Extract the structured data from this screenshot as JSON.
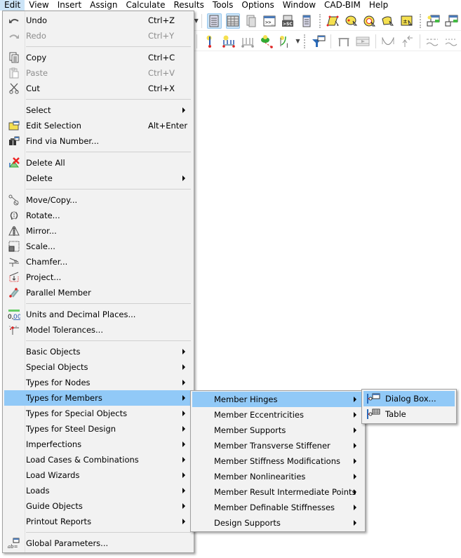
{
  "menubar": {
    "items": [
      "Edit",
      "View",
      "Insert",
      "Assign",
      "Calculate",
      "Results",
      "Tools",
      "Options",
      "Window",
      "CAD-BIM",
      "Help"
    ],
    "active": "Edit"
  },
  "toolbar1": {
    "icons": [
      "dropdown-arrow-icon",
      "table-list-icon",
      "table-grid-icon",
      "report-icon",
      "console-icon",
      "script-icon",
      "list-icon",
      "surface-select-icon",
      "solid-select-icon",
      "opening-select-icon",
      "area-select-icon",
      "value-select-icon",
      "copy-model-icon",
      "export-model-icon"
    ]
  },
  "toolbar2": {
    "icons": [
      "node-load-icon",
      "member-load-icon",
      "member-load-disabled-icon",
      "surface-load-icon",
      "free-load-icon",
      "filter-icon",
      "frame-icon",
      "film-icon",
      "deformation-icon",
      "arrows-icon",
      "line-wave-icon",
      "line-wave2-icon"
    ]
  },
  "edit_menu": {
    "items": [
      {
        "type": "item",
        "label": "Undo",
        "shortcut": "Ctrl+Z",
        "icon": "undo-icon",
        "disabled": false
      },
      {
        "type": "item",
        "label": "Redo",
        "shortcut": "Ctrl+Y",
        "icon": "redo-icon",
        "disabled": true
      },
      {
        "type": "separator"
      },
      {
        "type": "item",
        "label": "Copy",
        "shortcut": "Ctrl+C",
        "icon": "copy-icon",
        "disabled": false
      },
      {
        "type": "item",
        "label": "Paste",
        "shortcut": "Ctrl+V",
        "icon": "paste-icon",
        "disabled": true
      },
      {
        "type": "item",
        "label": "Cut",
        "shortcut": "Ctrl+X",
        "icon": "cut-icon",
        "disabled": false
      },
      {
        "type": "separator"
      },
      {
        "type": "item",
        "label": "Select",
        "submenu": true
      },
      {
        "type": "item",
        "label": "Edit Selection",
        "shortcut": "Alt+Enter",
        "icon": "edit-selection-icon"
      },
      {
        "type": "item",
        "label": "Find via Number...",
        "icon": "binoculars-icon"
      },
      {
        "type": "separator"
      },
      {
        "type": "item",
        "label": "Delete All",
        "icon": "delete-all-icon"
      },
      {
        "type": "item",
        "label": "Delete",
        "submenu": true
      },
      {
        "type": "separator"
      },
      {
        "type": "item",
        "label": "Move/Copy...",
        "icon": "move-copy-icon"
      },
      {
        "type": "item",
        "label": "Rotate...",
        "icon": "rotate-icon"
      },
      {
        "type": "item",
        "label": "Mirror...",
        "icon": "mirror-icon"
      },
      {
        "type": "item",
        "label": "Scale...",
        "icon": "scale-icon"
      },
      {
        "type": "item",
        "label": "Chamfer...",
        "icon": "chamfer-icon"
      },
      {
        "type": "item",
        "label": "Project...",
        "icon": "project-icon"
      },
      {
        "type": "item",
        "label": "Parallel Member",
        "icon": "parallel-member-icon"
      },
      {
        "type": "separator"
      },
      {
        "type": "item",
        "label": "Units and Decimal Places...",
        "icon": "units-icon"
      },
      {
        "type": "item",
        "label": "Model Tolerances...",
        "icon": "tolerances-icon"
      },
      {
        "type": "separator"
      },
      {
        "type": "item",
        "label": "Basic Objects",
        "submenu": true
      },
      {
        "type": "item",
        "label": "Special Objects",
        "submenu": true
      },
      {
        "type": "item",
        "label": "Types for Nodes",
        "submenu": true
      },
      {
        "type": "item",
        "label": "Types for Members",
        "submenu": true,
        "highlighted": true
      },
      {
        "type": "item",
        "label": "Types for Special Objects",
        "submenu": true
      },
      {
        "type": "item",
        "label": "Types for Steel Design",
        "submenu": true
      },
      {
        "type": "item",
        "label": "Imperfections",
        "submenu": true
      },
      {
        "type": "item",
        "label": "Load Cases & Combinations",
        "submenu": true
      },
      {
        "type": "item",
        "label": "Load Wizards",
        "submenu": true
      },
      {
        "type": "item",
        "label": "Loads",
        "submenu": true
      },
      {
        "type": "item",
        "label": "Guide Objects",
        "submenu": true
      },
      {
        "type": "item",
        "label": "Printout Reports",
        "submenu": true
      },
      {
        "type": "separator"
      },
      {
        "type": "item",
        "label": "Global Parameters...",
        "icon": "global-parameters-icon"
      }
    ]
  },
  "members_menu": {
    "items": [
      {
        "label": "Member Hinges",
        "highlighted": true
      },
      {
        "label": "Member Eccentricities"
      },
      {
        "label": "Member Supports"
      },
      {
        "label": "Member Transverse Stiffener"
      },
      {
        "label": "Member Stiffness Modifications"
      },
      {
        "label": "Member Nonlinearities"
      },
      {
        "label": "Member Result Intermediate Points"
      },
      {
        "label": "Member Definable Stiffnesses"
      },
      {
        "label": "Design Supports"
      }
    ]
  },
  "hinges_menu": {
    "items": [
      {
        "label": "Dialog Box...",
        "icon": "hinge-dialog-icon",
        "highlighted": true
      },
      {
        "label": "Table",
        "icon": "hinge-table-icon"
      }
    ]
  },
  "colors": {
    "highlight": "#91c9f7",
    "menu_bg": "#f2f2f2",
    "menubar_active": "#cce4f7"
  }
}
